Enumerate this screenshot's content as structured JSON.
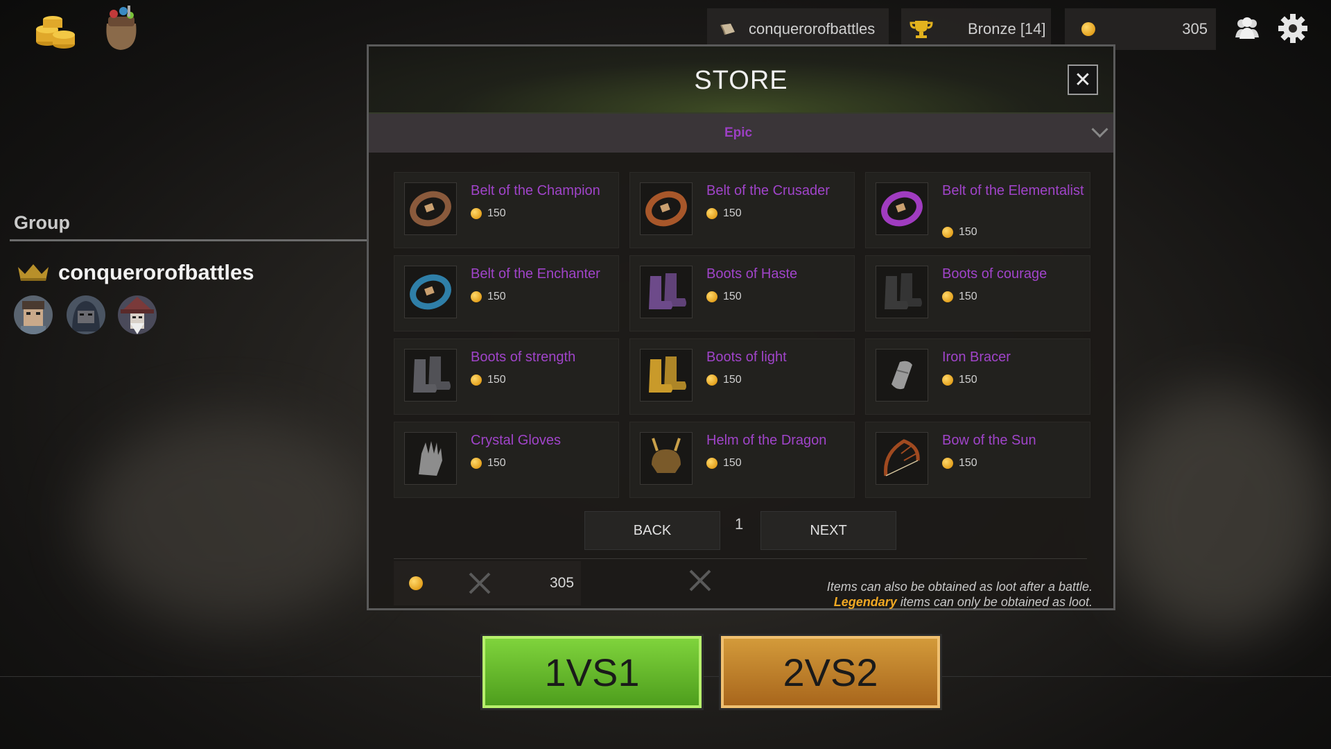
{
  "topbar": {
    "username": "conquerorofbattles",
    "rank": "Bronze [14]",
    "currency": "305",
    "icons": [
      "coins-stack-icon",
      "loot-bag-icon",
      "scroll-icon",
      "trophy-icon",
      "coin-icon",
      "friends-icon",
      "gear-icon"
    ]
  },
  "group": {
    "title": "Group",
    "leader": "conquerorofbattles",
    "leader_icon": "crown-icon",
    "members": [
      "knight-avatar",
      "hooded-avatar",
      "wizard-avatar"
    ]
  },
  "store": {
    "title": "STORE",
    "filter": "Epic",
    "items": [
      {
        "name": "Belt of the Champion",
        "price": "150",
        "icon": "brown-belt-icon",
        "color": "#8a5a3c"
      },
      {
        "name": "Belt of the Crusader",
        "price": "150",
        "icon": "orange-belt-icon",
        "color": "#a8572a"
      },
      {
        "name": "Belt of the Elementalist",
        "price": "150",
        "icon": "purple-belt-icon",
        "color": "#a03cc0"
      },
      {
        "name": "Belt of the Enchanter",
        "price": "150",
        "icon": "blue-belt-icon",
        "color": "#2f7fa8"
      },
      {
        "name": "Boots of Haste",
        "price": "150",
        "icon": "purple-boots-icon",
        "color": "#6d4a8a"
      },
      {
        "name": "Boots of courage",
        "price": "150",
        "icon": "black-boots-icon",
        "color": "#3a3a3a"
      },
      {
        "name": "Boots of strength",
        "price": "150",
        "icon": "grey-boots-icon",
        "color": "#5c5c62"
      },
      {
        "name": "Boots of light",
        "price": "150",
        "icon": "gold-boots-icon",
        "color": "#c99a2a"
      },
      {
        "name": "Iron Bracer",
        "price": "150",
        "icon": "bracer-icon",
        "color": "#9a9a9a"
      },
      {
        "name": "Crystal Gloves",
        "price": "150",
        "icon": "gauntlet-icon",
        "color": "#8d8d8d"
      },
      {
        "name": "Helm of the Dragon",
        "price": "150",
        "icon": "helm-icon",
        "color": "#7a5a2a"
      },
      {
        "name": "Bow of the Sun",
        "price": "150",
        "icon": "bow-icon",
        "color": "#a04a20"
      }
    ],
    "back_label": "BACK",
    "next_label": "NEXT",
    "page": "1",
    "balance": "305",
    "note_line1": "Items can also be obtained as loot after a battle.",
    "note_legendary": "Legendary",
    "note_line2_rest": " items can only be obtained as loot.",
    "close_icon": "close-icon"
  },
  "modes": {
    "one": "1VS1",
    "two": "2VS2"
  }
}
